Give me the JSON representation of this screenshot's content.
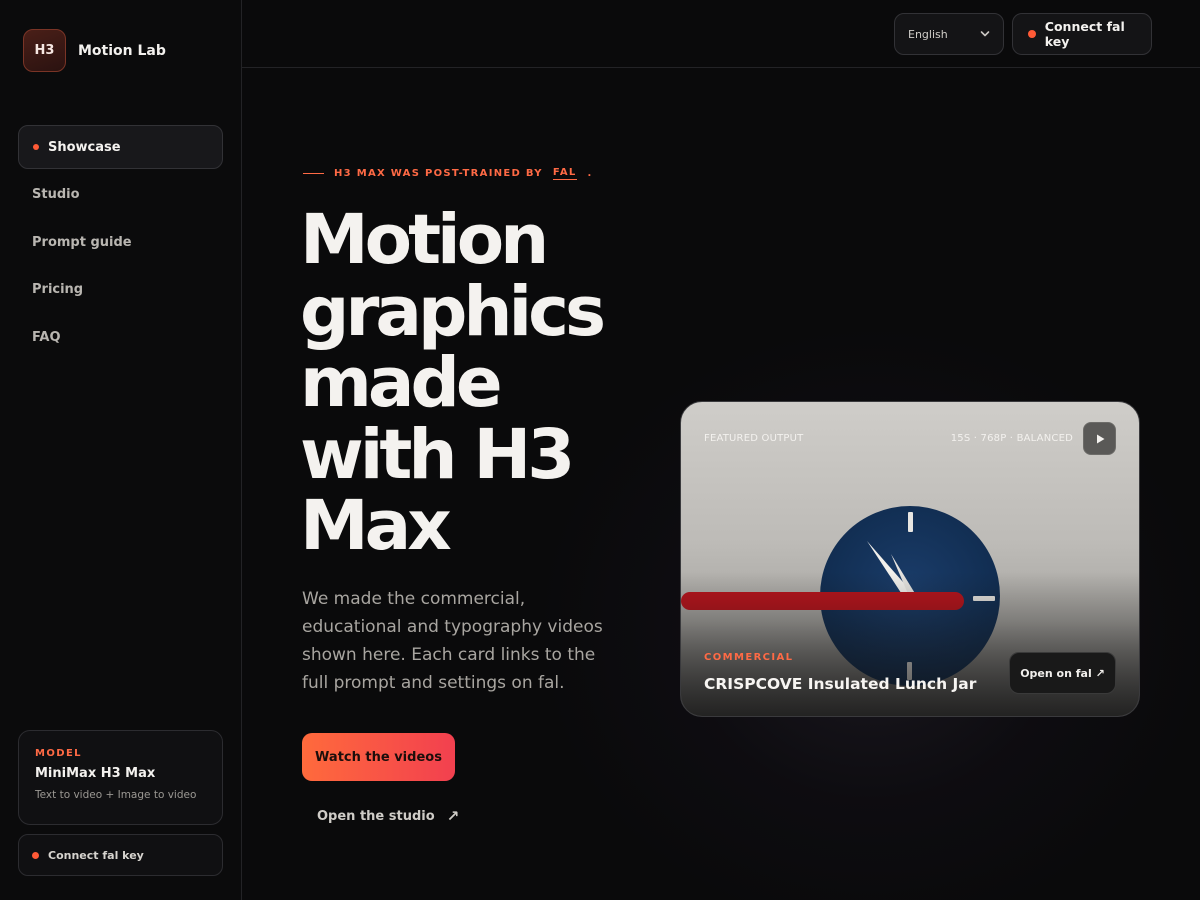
{
  "brand": {
    "logo": "H3",
    "name": "Motion Lab"
  },
  "sidebar": {
    "items": [
      {
        "label": "Showcase",
        "active": true
      },
      {
        "label": "Studio"
      },
      {
        "label": "Prompt guide"
      },
      {
        "label": "Pricing"
      },
      {
        "label": "FAQ"
      }
    ],
    "model": {
      "kicker": "MODEL",
      "name": "MiniMax H3 Max",
      "desc": "Text to video + Image to video"
    },
    "connect_label": "Connect fal key"
  },
  "topbar": {
    "language": "English",
    "connect_label": "Connect fal key"
  },
  "hero": {
    "kicker": "H3 MAX WAS POST-TRAINED BY",
    "kicker_link": "FAL",
    "kicker_end": ".",
    "headline_lines": [
      "Motion",
      "graphics",
      "made",
      "with H3",
      "Max"
    ],
    "lede": "We made the commercial, educational and typography videos shown here. Each card links to the full prompt and settings on fal.",
    "cta_primary": "Watch the videos",
    "cta_secondary": "Open the studio",
    "cta_secondary_arrow": "↗"
  },
  "featured": {
    "label": "FEATURED OUTPUT",
    "meta": "15S · 768P · BALANCED",
    "tag": "COMMERCIAL",
    "title": "CRISPCOVE Insulated Lunch Jar",
    "open_label": "Open on fal ↗"
  },
  "colors": {
    "accent": "#ff5a36",
    "accent_text": "#ff6a45",
    "background": "#0a0a0b",
    "clock_face": "#123057",
    "red_bar": "#b8141c"
  },
  "icons": {
    "language_chevron": "chevron-down-icon",
    "play": "play-icon",
    "external": "arrow-up-right-icon"
  }
}
